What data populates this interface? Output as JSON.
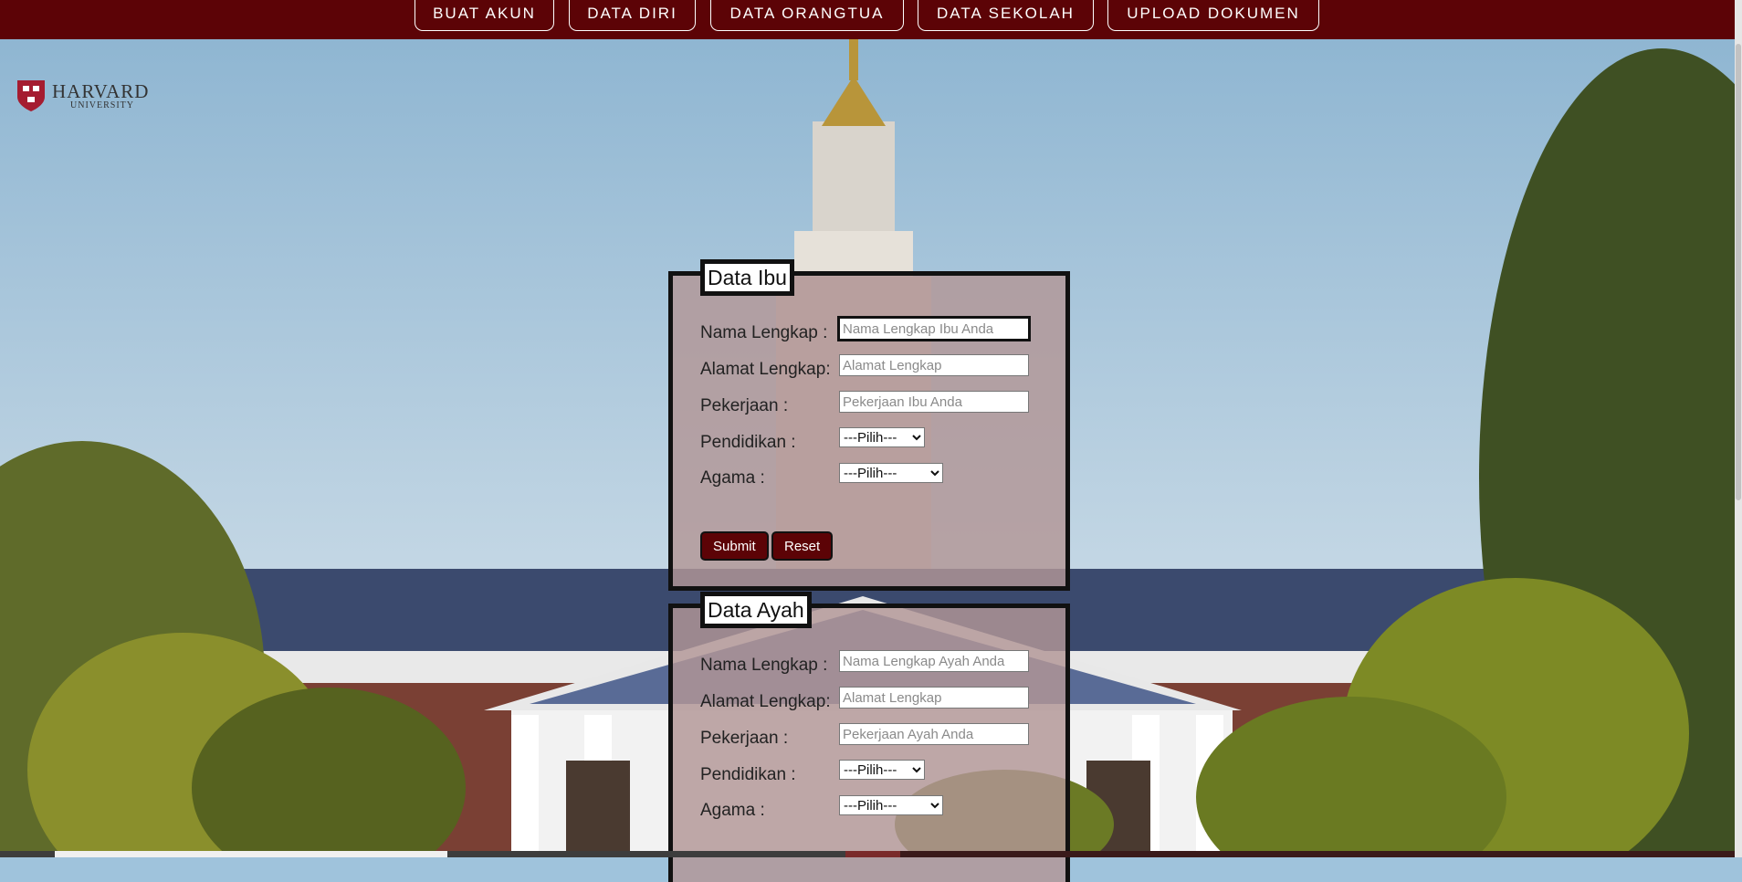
{
  "nav": {
    "items": [
      {
        "label": "BUAT AKUN"
      },
      {
        "label": "DATA DIRI"
      },
      {
        "label": "DATA ORANGTUA"
      },
      {
        "label": "DATA SEKOLAH"
      },
      {
        "label": "UPLOAD DOKUMEN"
      }
    ]
  },
  "logo": {
    "name": "HARVARD",
    "sub": "UNIVERSITY"
  },
  "ibu": {
    "legend": "Data Ibu",
    "nama_label": "Nama Lengkap :",
    "nama_placeholder": "Nama Lengkap Ibu Anda",
    "alamat_label": "Alamat Lengkap:",
    "alamat_placeholder": "Alamat Lengkap",
    "pekerjaan_label": "Pekerjaan :",
    "pekerjaan_placeholder": "Pekerjaan Ibu Anda",
    "pendidikan_label": "Pendidikan :",
    "pendidikan_value": "---Pilih---",
    "agama_label": "Agama :",
    "agama_value": "---Pilih---",
    "submit": "Submit",
    "reset": "Reset"
  },
  "ayah": {
    "legend": "Data Ayah",
    "nama_label": "Nama Lengkap :",
    "nama_placeholder": "Nama Lengkap Ayah Anda",
    "alamat_label": "Alamat Lengkap:",
    "alamat_placeholder": "Alamat Lengkap",
    "pekerjaan_label": "Pekerjaan :",
    "pekerjaan_placeholder": "Pekerjaan Ayah Anda",
    "pendidikan_label": "Pendidikan :",
    "pendidikan_value": "---Pilih---",
    "agama_label": "Agama :",
    "agama_value": "---Pilih---"
  },
  "colors": {
    "brand": "#5c0306",
    "panel": "#b29696",
    "sky": "#9fc3dc"
  }
}
